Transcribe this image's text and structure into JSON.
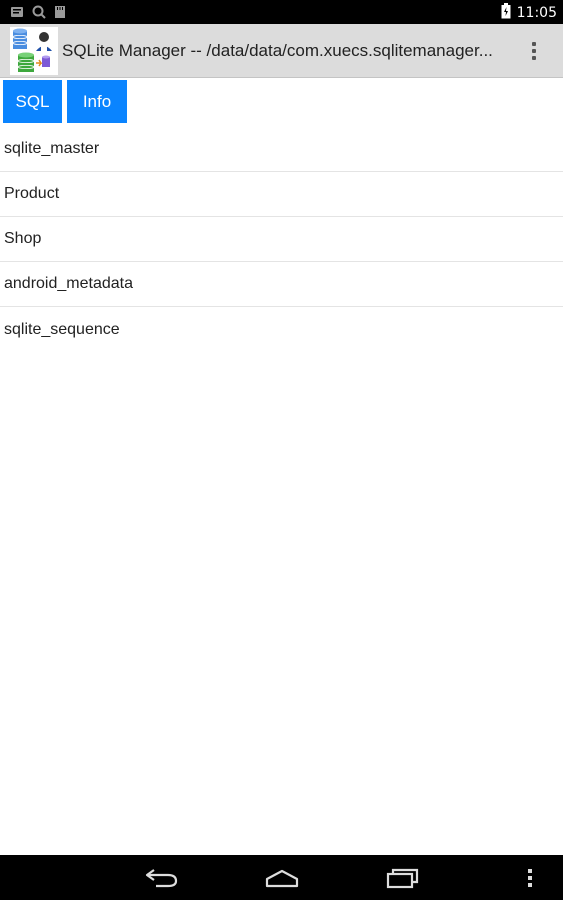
{
  "status_bar": {
    "time": "11:05",
    "left_icons": [
      "notification-icon",
      "search-icon",
      "sd-card-icon"
    ],
    "battery_icon": "battery-icon"
  },
  "action_bar": {
    "app_icon": "sqlite-manager-app-icon",
    "title": "SQLite Manager -- /data/data/com.xuecs.sqlitemanager...",
    "overflow_icon": "overflow-menu-icon",
    "background": "#dcdcdc"
  },
  "buttons": {
    "sql_label": "SQL",
    "info_label": "Info",
    "color": "#0a84ff"
  },
  "tables": [
    {
      "name": "sqlite_master"
    },
    {
      "name": "Product"
    },
    {
      "name": "Shop"
    },
    {
      "name": "android_metadata"
    },
    {
      "name": "sqlite_sequence"
    }
  ],
  "nav_bar": {
    "back_icon": "back-icon",
    "home_icon": "home-icon",
    "recents_icon": "recent-apps-icon",
    "menu_icon": "menu-icon"
  }
}
